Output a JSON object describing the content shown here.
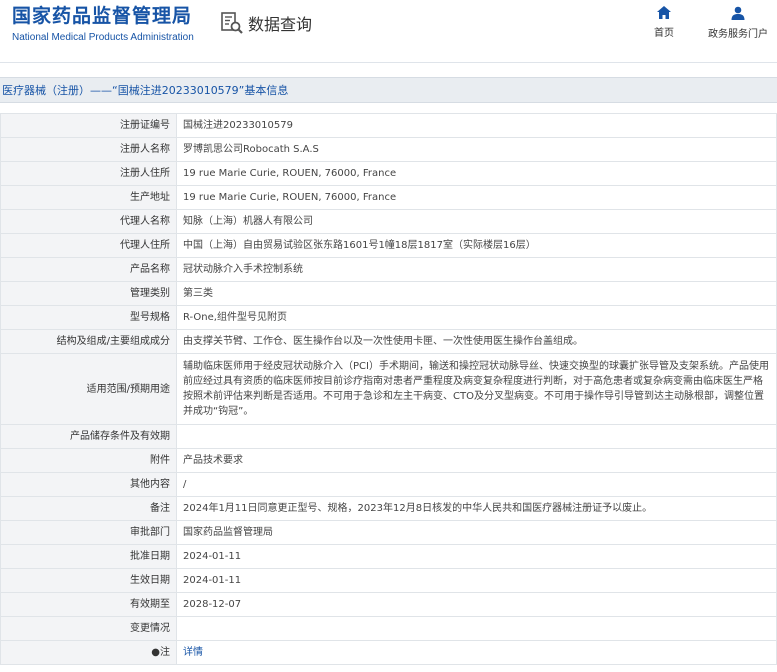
{
  "header": {
    "logo_cn": "国家药品监督管理局",
    "logo_en": "National Medical Products Administration",
    "query_title": "数据查询",
    "nav": {
      "home": "首页",
      "portal": "政务服务门户"
    },
    "colors": {
      "brand": "#1754a6"
    }
  },
  "title_bar": "医疗器械（注册）——“国械注进20233010579”基本信息",
  "rows": [
    {
      "label": "注册证编号",
      "value": "国械注进20233010579"
    },
    {
      "label": "注册人名称",
      "value": "罗博凯思公司Robocath S.A.S"
    },
    {
      "label": "注册人住所",
      "value": "19 rue Marie Curie, ROUEN, 76000, France"
    },
    {
      "label": "生产地址",
      "value": "19 rue Marie Curie, ROUEN, 76000, France"
    },
    {
      "label": "代理人名称",
      "value": "知脉（上海）机器人有限公司"
    },
    {
      "label": "代理人住所",
      "value": "中国（上海）自由贸易试验区张东路1601号1幢18层1817室（实际楼层16层）"
    },
    {
      "label": "产品名称",
      "value": "冠状动脉介入手术控制系统"
    },
    {
      "label": "管理类别",
      "value": "第三类"
    },
    {
      "label": "型号规格",
      "value": "R-One,组件型号见附页"
    },
    {
      "label": "结构及组成/主要组成成分",
      "value": "由支撑关节臂、工作仓、医生操作台以及一次性使用卡匣、一次性使用医生操作台盖组成。"
    },
    {
      "label": "适用范围/预期用途",
      "value": "辅助临床医师用于经皮冠状动脉介入（PCI）手术期间，输送和操控冠状动脉导丝、快速交换型的球囊扩张导管及支架系统。产品使用前应经过具有资质的临床医师按目前诊疗指南对患者严重程度及病变复杂程度进行判断，对于高危患者或复杂病变需由临床医生严格按照术前评估来判断是否适用。不可用于急诊和左主干病变、CTO及分叉型病变。不可用于操作导引导管到达主动脉根部，调整位置并成功“钩冠”。"
    },
    {
      "label": "产品储存条件及有效期",
      "value": ""
    },
    {
      "label": "附件",
      "value": "产品技术要求"
    },
    {
      "label": "其他内容",
      "value": "/"
    },
    {
      "label": "备注",
      "value": "2024年1月11日同意更正型号、规格，2023年12月8日核发的中华人民共和国医疗器械注册证予以废止。"
    },
    {
      "label": "审批部门",
      "value": "国家药品监督管理局"
    },
    {
      "label": "批准日期",
      "value": "2024-01-11"
    },
    {
      "label": "生效日期",
      "value": "2024-01-11"
    },
    {
      "label": "有效期至",
      "value": "2028-12-07"
    },
    {
      "label": "变更情况",
      "value": ""
    },
    {
      "label": "●注",
      "value": "详情"
    }
  ]
}
